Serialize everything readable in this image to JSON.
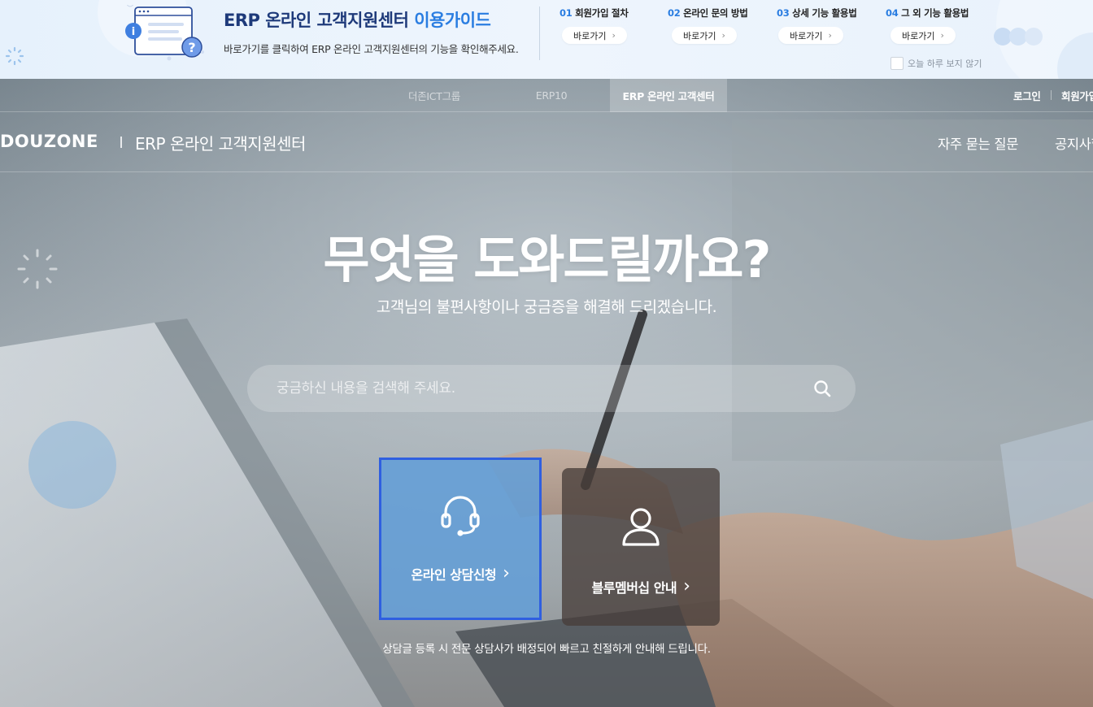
{
  "guide": {
    "title_main": "ERP 온라인 고객지원센터 ",
    "title_highlight": "이용가이드",
    "description": "바로가기를 클릭하여 ERP 온라인 고객지원센터의 기능을 확인해주세요.",
    "steps": [
      {
        "num": "01",
        "label": " 회원가입 절차",
        "button": "바로가기"
      },
      {
        "num": "02",
        "label": " 온라인 문의 방법",
        "button": "바로가기"
      },
      {
        "num": "03",
        "label": " 상세 기능 활용법",
        "button": "바로가기"
      },
      {
        "num": "04",
        "label": " 그 외 기능 활용법",
        "button": "바로가기"
      }
    ],
    "hide_today": "오늘 하루 보지 않기",
    "colors": {
      "accent": "#2a7de1",
      "title": "#1e3a7a"
    }
  },
  "gnb": {
    "items": [
      "더존ICT그룹",
      "ERP10",
      "ERP 온라인 고객센터"
    ],
    "active_index": 2,
    "login": "로그인",
    "join": "회원가입"
  },
  "header": {
    "logo": "DOUZONE",
    "site_name": "ERP 온라인 고객지원센터",
    "menu": [
      "자주 묻는 질문",
      "공지사항"
    ]
  },
  "hero": {
    "headline": "무엇을 도와드릴까요?",
    "subtitle": "고객님의 불편사항이나 궁금증을 해결해 드리겠습니다.",
    "search_placeholder": "궁금하신 내용을 검색해 주세요.",
    "search_icon": "search-icon"
  },
  "cards": [
    {
      "label": "온라인 상담신청",
      "icon": "headset-icon",
      "color": "#639ed7"
    },
    {
      "label": "블루멤버십 안내",
      "icon": "user-icon",
      "color": "#483e3a"
    }
  ],
  "note": "상담글 등록 시 전문 상담사가 배정되어 빠르고 친절하게 안내해 드립니다.",
  "chevron": "›"
}
